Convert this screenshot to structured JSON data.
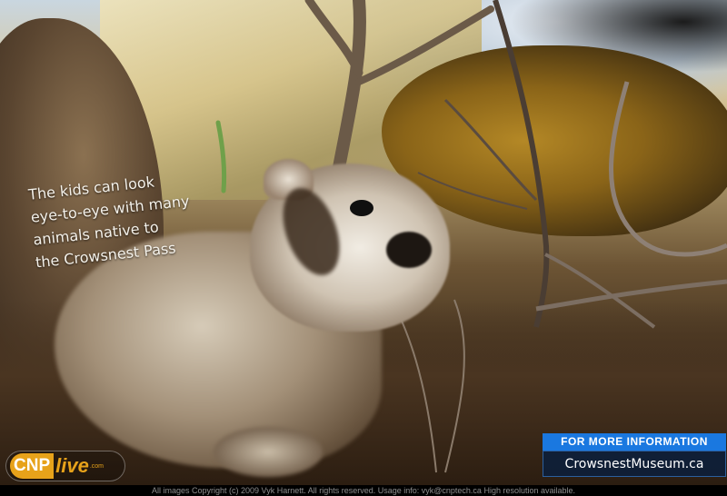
{
  "caption": {
    "line1": "The kids can look",
    "line2": "eye-to-eye with many",
    "line3": "animals native to",
    "line4": "the Crowsnest Pass"
  },
  "logo": {
    "part1": "CNP",
    "part2": "live",
    "part3": ".com"
  },
  "info_box": {
    "header": "FOR MORE INFORMATION",
    "website": "CrowsnestMuseum.ca"
  },
  "footer": {
    "copyright": "All images Copyright (c) 2009 Vyk Harnett.  All rights reserved. Usage info: vyk@cnptech.ca  High resolution available."
  },
  "colors": {
    "info_header_bg": "#1a78e0",
    "logo_orange": "#e7a21a"
  }
}
